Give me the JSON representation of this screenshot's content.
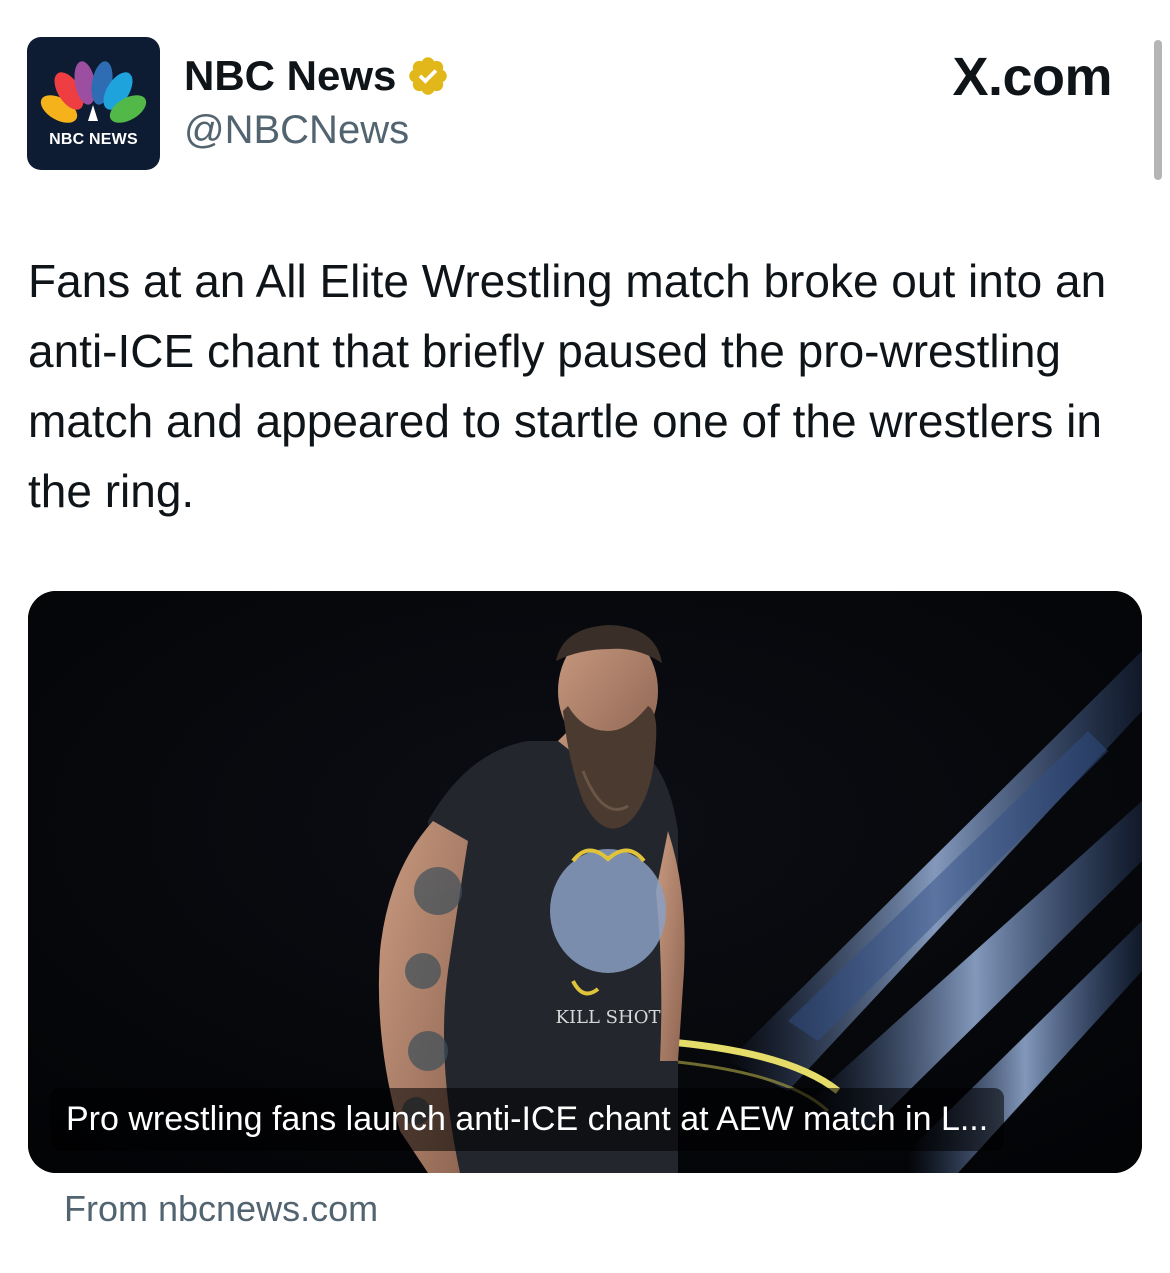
{
  "author": {
    "display_name": "NBC News",
    "handle": "@NBCNews",
    "avatar_label": "NBC NEWS",
    "verified_badge": "gold-checkmark-icon",
    "badge_color": "#e2b719"
  },
  "site_label": "X.com",
  "post": {
    "text": "Fans at an All Elite Wrestling match broke out into an anti-ICE chant that briefly paused the pro-wrestling match and appeared to startle one of the wrestlers in the ring."
  },
  "link_card": {
    "caption": "Pro wrestling fans launch anti-ICE chant at AEW match in L...",
    "source": "From nbcnews.com",
    "shirt_text": "KILL SHOT"
  },
  "colors": {
    "text_primary": "#0f1419",
    "text_secondary": "#536471",
    "avatar_bg": "#0d1b33"
  }
}
